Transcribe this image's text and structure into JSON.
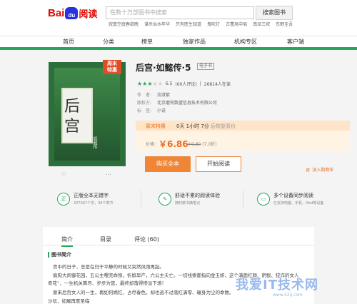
{
  "header": {
    "logo": {
      "bai": "Bai",
      "du": "du",
      "yuedu": "阅读"
    },
    "search_placeholder": "在数十万部图书中搜索",
    "search_button": "搜索图书",
    "hot_words": [
      "寂寞空庭春欲晚",
      "谋杀似水年华",
      "只有医生知道",
      "鬼吹灯",
      "古董局中局",
      "南派三叔",
      "东野圭吾"
    ]
  },
  "nav": {
    "items": [
      "首页",
      "分类",
      "榜单",
      "独家作品",
      "机构专区",
      "客户端"
    ]
  },
  "book": {
    "badge_line1": "周末",
    "badge_line2": "特惠",
    "cover_char1": "后",
    "cover_char2": "宫",
    "cover_sub": "如懿传",
    "title": "后宫·如懿传·5",
    "type_tag": "电子书",
    "rating_score": "6.5",
    "rating_count": "(60人评论)",
    "readers": "26814人在读",
    "author_label": "作　者:",
    "author": "流潋紫",
    "publisher_label": "版权方:",
    "publisher": "北京磨铁数盟信息技术有限公司",
    "tag_label": "标　签:",
    "tag": "小说"
  },
  "promo": {
    "label": "周末特惠",
    "countdown": "0天 1小时 7分",
    "countdown_tail": "后恢复原价",
    "price_label": "价格:",
    "price": "￥6.86",
    "orig_price": "￥9.80",
    "discount": "(7.0折)"
  },
  "actions": {
    "buy": "购买全本",
    "read": "开始阅读",
    "cart": "加入购物车"
  },
  "features": [
    {
      "icon": "正",
      "title": "正版全本无错字",
      "sub": "207067个字，30个章节"
    },
    {
      "icon": "✎",
      "title": "舒适不累的阅读体验",
      "sub": "随时做书摘笔记"
    },
    {
      "icon": "▭",
      "title": "多个设备同步阅读",
      "sub": "已支持电脑、手机、iPad等设备"
    }
  ],
  "tabs": [
    "简介",
    "目录",
    "评论 (60)"
  ],
  "intro": {
    "heading": "图书简介",
    "paragraphs": [
      "宫中的日子，总是在归于平静的时候又突然风雨再起。",
      "疯狗大闹御花园，五公主嘤完命殒，忻嫔早产，六公主夭亡。一切线索都指向金玉妍，这个满面红颜、阴狠、狡诈的女人",
      "奇花”、一生机关算尽、步步为营，最终却落得惨淡下场！",
      "原来后宫女人的一生，再如何嫣红、占尽春色，却也逃不过落红满零、碾身为尘的命数。",
      "沙坛，如履再度圣临"
    ]
  },
  "watermark": {
    "text": "我爱IT技术网",
    "url": "www.52ij.com"
  }
}
